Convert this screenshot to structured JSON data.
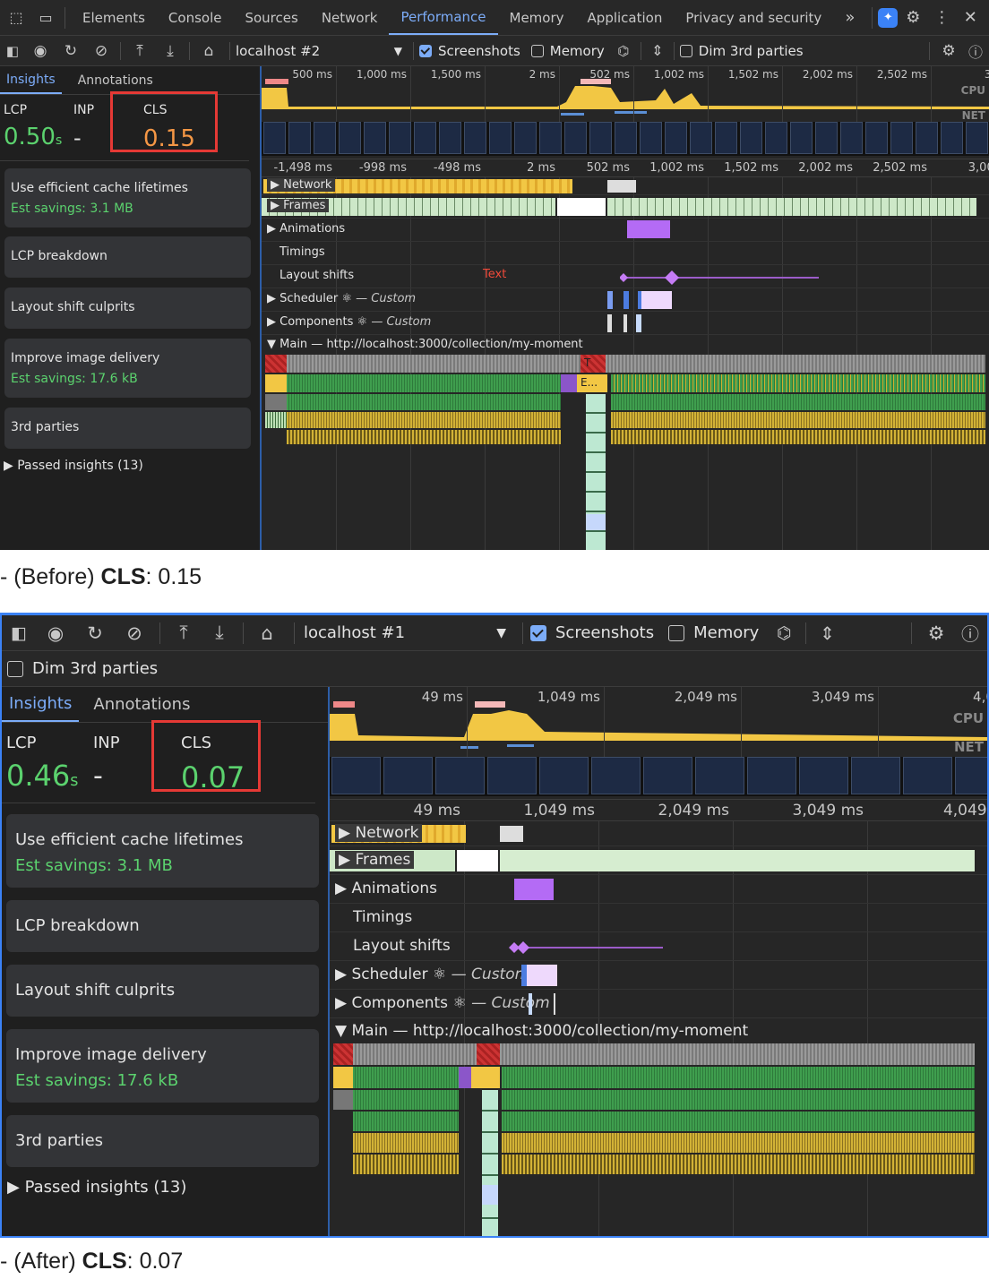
{
  "before": {
    "caption_prefix": "- (Before) ",
    "caption_key": "CLS",
    "caption_value": ": 0.15",
    "tabs": [
      "Elements",
      "Console",
      "Sources",
      "Network",
      "Performance",
      "Memory",
      "Application",
      "Privacy and security"
    ],
    "more_tabs": "»",
    "target": "localhost #2",
    "screenshots_label": "Screenshots",
    "memory_label": "Memory",
    "dim_label": "Dim 3rd parties",
    "side_tabs": [
      "Insights",
      "Annotations"
    ],
    "lcp_label": "LCP",
    "lcp_value": "0.50",
    "lcp_unit": "s",
    "inp_label": "INP",
    "inp_value": "-",
    "cls_label": "CLS",
    "cls_value": "0.15",
    "insights": [
      {
        "title": "Use efficient cache lifetimes",
        "savings": "Est savings: 3.1 MB"
      },
      {
        "title": "LCP breakdown",
        "savings": ""
      },
      {
        "title": "Layout shift culprits",
        "savings": ""
      },
      {
        "title": "Improve image delivery",
        "savings": "Est savings: 17.6 kB"
      },
      {
        "title": "3rd parties",
        "savings": ""
      }
    ],
    "passed": "▶ Passed insights (13)",
    "overview_ticks": [
      "500 ms",
      "1,000 ms",
      "1,500 ms",
      "2 ms",
      "502 ms",
      "1,002 ms",
      "1,502 ms",
      "2,002 ms",
      "2,502 ms",
      "3,0"
    ],
    "main_ticks": [
      "-1,498 ms",
      "-998 ms",
      "-498 ms",
      "2 ms",
      "502 ms",
      "1,002 ms",
      "1,502 ms",
      "2,002 ms",
      "2,502 ms",
      "3,002"
    ],
    "cpu": "CPU",
    "net": "NET",
    "tracks": {
      "network": "Network",
      "frames": "Frames",
      "animations": "Animations",
      "timings": "Timings",
      "layout_shifts": "Layout shifts",
      "text_note": "Text",
      "scheduler": "Scheduler",
      "components": "Components",
      "custom": "— Custom",
      "main": "Main — http://localhost:3000/collection/my-moment",
      "e_label": "E...",
      "t_label": "T"
    }
  },
  "after": {
    "caption_prefix": "- (After) ",
    "caption_key": "CLS",
    "caption_value": ": 0.07",
    "target": "localhost #1",
    "screenshots_label": "Screenshots",
    "memory_label": "Memory",
    "dim_label": "Dim 3rd parties",
    "side_tabs": [
      "Insights",
      "Annotations"
    ],
    "lcp_label": "LCP",
    "lcp_value": "0.46",
    "lcp_unit": "s",
    "inp_label": "INP",
    "inp_value": "-",
    "cls_label": "CLS",
    "cls_value": "0.07",
    "insights": [
      {
        "title": "Use efficient cache lifetimes",
        "savings": "Est savings: 3.1 MB"
      },
      {
        "title": "LCP breakdown",
        "savings": ""
      },
      {
        "title": "Layout shift culprits",
        "savings": ""
      },
      {
        "title": "Improve image delivery",
        "savings": "Est savings: 17.6 kB"
      },
      {
        "title": "3rd parties",
        "savings": ""
      }
    ],
    "passed": "▶ Passed insights (13)",
    "overview_ticks": [
      "49 ms",
      "1,049 ms",
      "2,049 ms",
      "3,049 ms",
      "4,049"
    ],
    "main_ticks": [
      "49 ms",
      "1,049 ms",
      "2,049 ms",
      "3,049 ms",
      "4,049 r"
    ],
    "cpu": "CPU",
    "net": "NET",
    "tracks": {
      "network": "Network",
      "frames": "Frames",
      "animations": "Animations",
      "timings": "Timings",
      "layout_shifts": "Layout shifts",
      "scheduler": "Scheduler",
      "components": "Components",
      "custom": "— Custom",
      "main": "Main — http://localhost:3000/collection/my-moment"
    }
  },
  "colors": {
    "accent": "#7cacf8",
    "good": "#5bd26e",
    "warn": "#f59745",
    "highlight": "#e53935"
  }
}
